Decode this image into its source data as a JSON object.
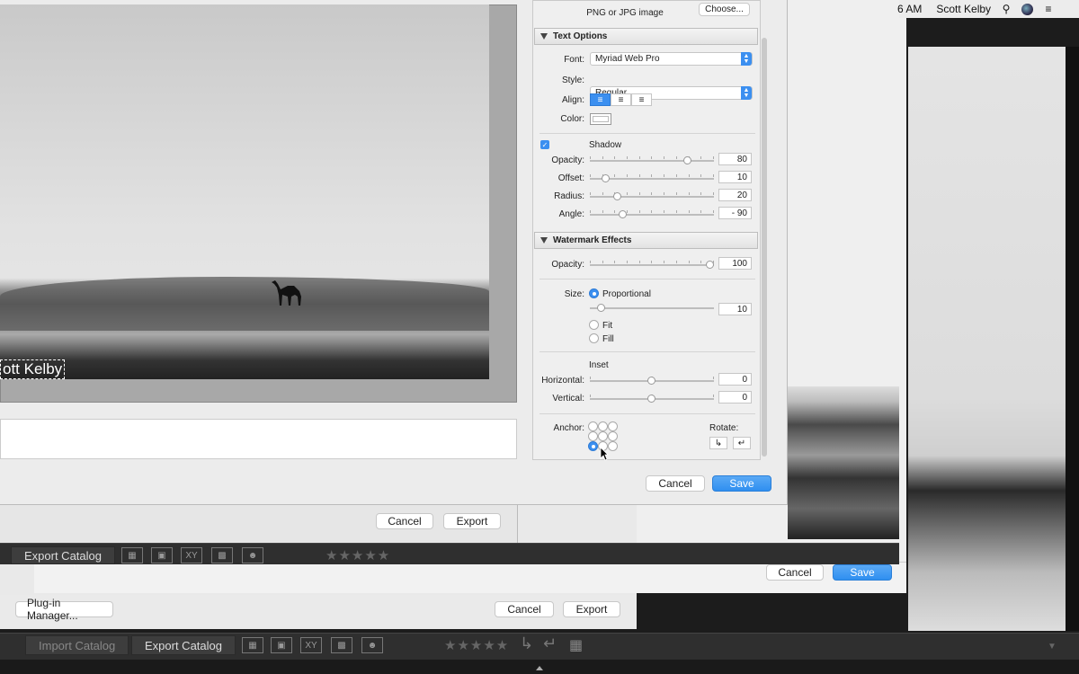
{
  "menubar": {
    "time": "6 AM",
    "user": "Scott Kelby"
  },
  "dialog": {
    "watermark_text": "ott Kelby",
    "cancel_label": "Cancel",
    "save_label": "Save",
    "image_hint_line1": "PNG or JPG image",
    "choose_label": "Choose...",
    "text_options": {
      "title": "Text Options",
      "font_label": "Font:",
      "font_value": "Myriad Web Pro",
      "style_label": "Style:",
      "style_value": "Regular",
      "align_label": "Align:",
      "color_label": "Color:",
      "shadow_label": "Shadow",
      "opacity_label": "Opacity:",
      "opacity_value": "80",
      "offset_label": "Offset:",
      "offset_value": "10",
      "radius_label": "Radius:",
      "radius_value": "20",
      "angle_label": "Angle:",
      "angle_value": "- 90"
    },
    "watermark_effects": {
      "title": "Watermark Effects",
      "opacity_label": "Opacity:",
      "opacity_value": "100",
      "size_label": "Size:",
      "proportional_label": "Proportional",
      "proportional_value": "10",
      "fit_label": "Fit",
      "fill_label": "Fill",
      "inset_label": "Inset",
      "horizontal_label": "Horizontal:",
      "horizontal_value": "0",
      "vertical_label": "Vertical:",
      "vertical_value": "0",
      "anchor_label": "Anchor:",
      "rotate_label": "Rotate:"
    }
  },
  "export_window": {
    "cancel_label": "Cancel",
    "export_label": "Export"
  },
  "catalog_toolbar": {
    "import_label": "Import Catalog",
    "export_label": "Export Catalog",
    "stars": "★★★★★"
  },
  "mid_window": {
    "cancel_label": "Cancel",
    "save_label": "Save"
  },
  "plugin_window": {
    "plugin_manager_label": "Plug-in Manager...",
    "cancel_label": "Cancel",
    "export_label": "Export"
  }
}
